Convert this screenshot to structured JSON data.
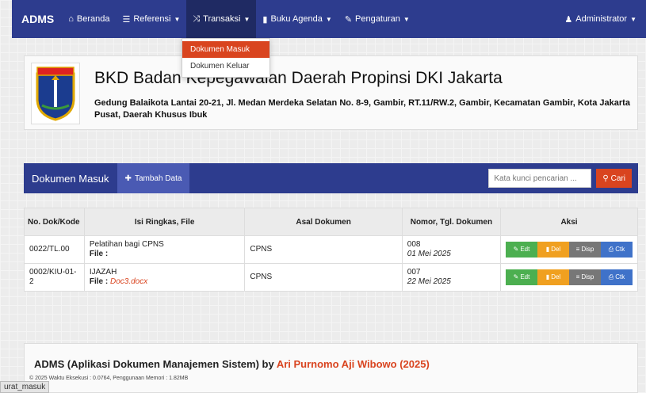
{
  "nav": {
    "brand": "ADMS",
    "items": [
      {
        "label": "Beranda",
        "icon": "home-icon",
        "caret": false
      },
      {
        "label": "Referensi",
        "icon": "list-icon",
        "caret": true
      },
      {
        "label": "Transaksi",
        "icon": "shuffle-icon",
        "caret": true
      },
      {
        "label": "Buku Agenda",
        "icon": "book-icon",
        "caret": true
      },
      {
        "label": "Pengaturan",
        "icon": "wrench-icon",
        "caret": true
      }
    ],
    "user": "Administrator"
  },
  "dropdown": {
    "items": [
      "Dokumen Masuk",
      "Dokumen Keluar"
    ]
  },
  "header": {
    "title": "BKD Badan Kepegawaian Daerah Propinsi DKI Jakarta",
    "address": "Gedung Balaikota Lantai 20-21, Jl. Medan Merdeka Selatan No. 8-9, Gambir, RT.11/RW.2, Gambir, Kecamatan Gambir, Kota Jakarta Pusat, Daerah Khusus Ibuk",
    "logo_text": "JAYA RAYA"
  },
  "panel": {
    "title": "Dokumen Masuk",
    "add_label": "Tambah Data",
    "search_placeholder": "Kata kunci pencarian ...",
    "search_button": "Cari"
  },
  "table": {
    "headers": [
      "No. Dok/Kode",
      "Isi Ringkas, File",
      "Asal Dokumen",
      "Nomor, Tgl. Dokumen",
      "Aksi"
    ],
    "file_label": "File :",
    "rows": [
      {
        "kode": "0022/TL.00",
        "isi": "Pelatihan bagi CPNS",
        "file": "",
        "asal": "CPNS",
        "nomor": "008",
        "tanggal": "01 Mei 2025"
      },
      {
        "kode": "0002/KIU-01-2",
        "isi": "IJAZAH",
        "file": "Doc3.docx",
        "asal": "CPNS",
        "nomor": "007",
        "tanggal": "22 Mei 2025"
      }
    ],
    "actions": {
      "edit": "Edt",
      "delete": "Del",
      "disp": "Disp",
      "print": "Ctk"
    }
  },
  "footer": {
    "title": "ADMS (Aplikasi Dokumen Manajemen Sistem) by",
    "author": "Ari Purnomo Aji Wibowo (2025)",
    "meta": "© 2025 Waktu Eksekusi : 0.0764, Penggunaan Memori : 1.82MB"
  },
  "status_tab": "urat_masuk",
  "colors": {
    "primary": "#2d3c8e",
    "accent": "#d9441f"
  }
}
